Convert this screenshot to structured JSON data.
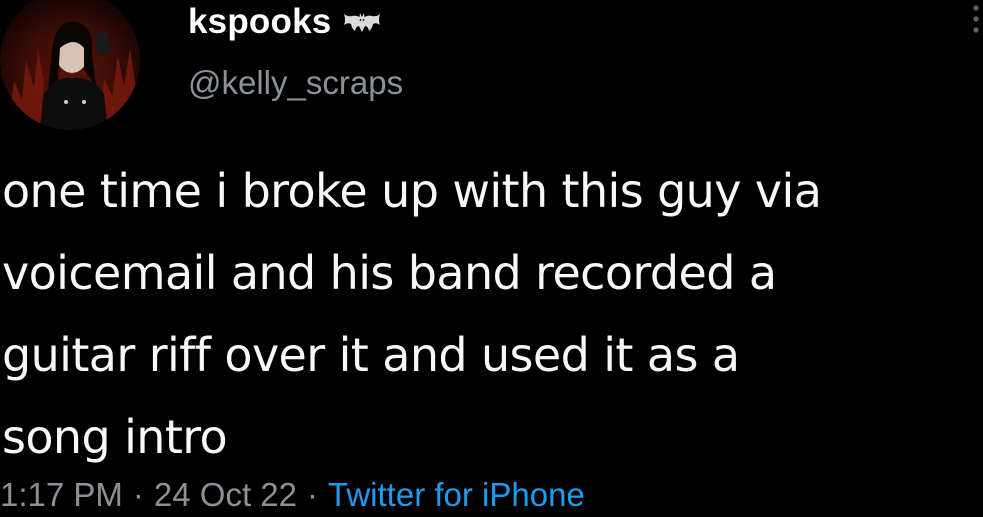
{
  "tweet": {
    "display_name": "kspooks",
    "handle": "@kelly_scraps",
    "text_lines": [
      "one time i broke up with this guy via",
      "voicemail and his band recorded a",
      "guitar riff over it and used it as a",
      "song intro"
    ],
    "time": "1:17 PM",
    "separator": "·",
    "date": "24 Oct 22",
    "source": "Twitter for iPhone"
  },
  "icons": {
    "name_badge": "bat-icon",
    "avatar": "profile-photo",
    "menu": "more-options-icon"
  },
  "colors": {
    "background": "#000000",
    "text": "#f7f9f9",
    "secondary": "#8b9196",
    "link": "#1d9bf0"
  }
}
